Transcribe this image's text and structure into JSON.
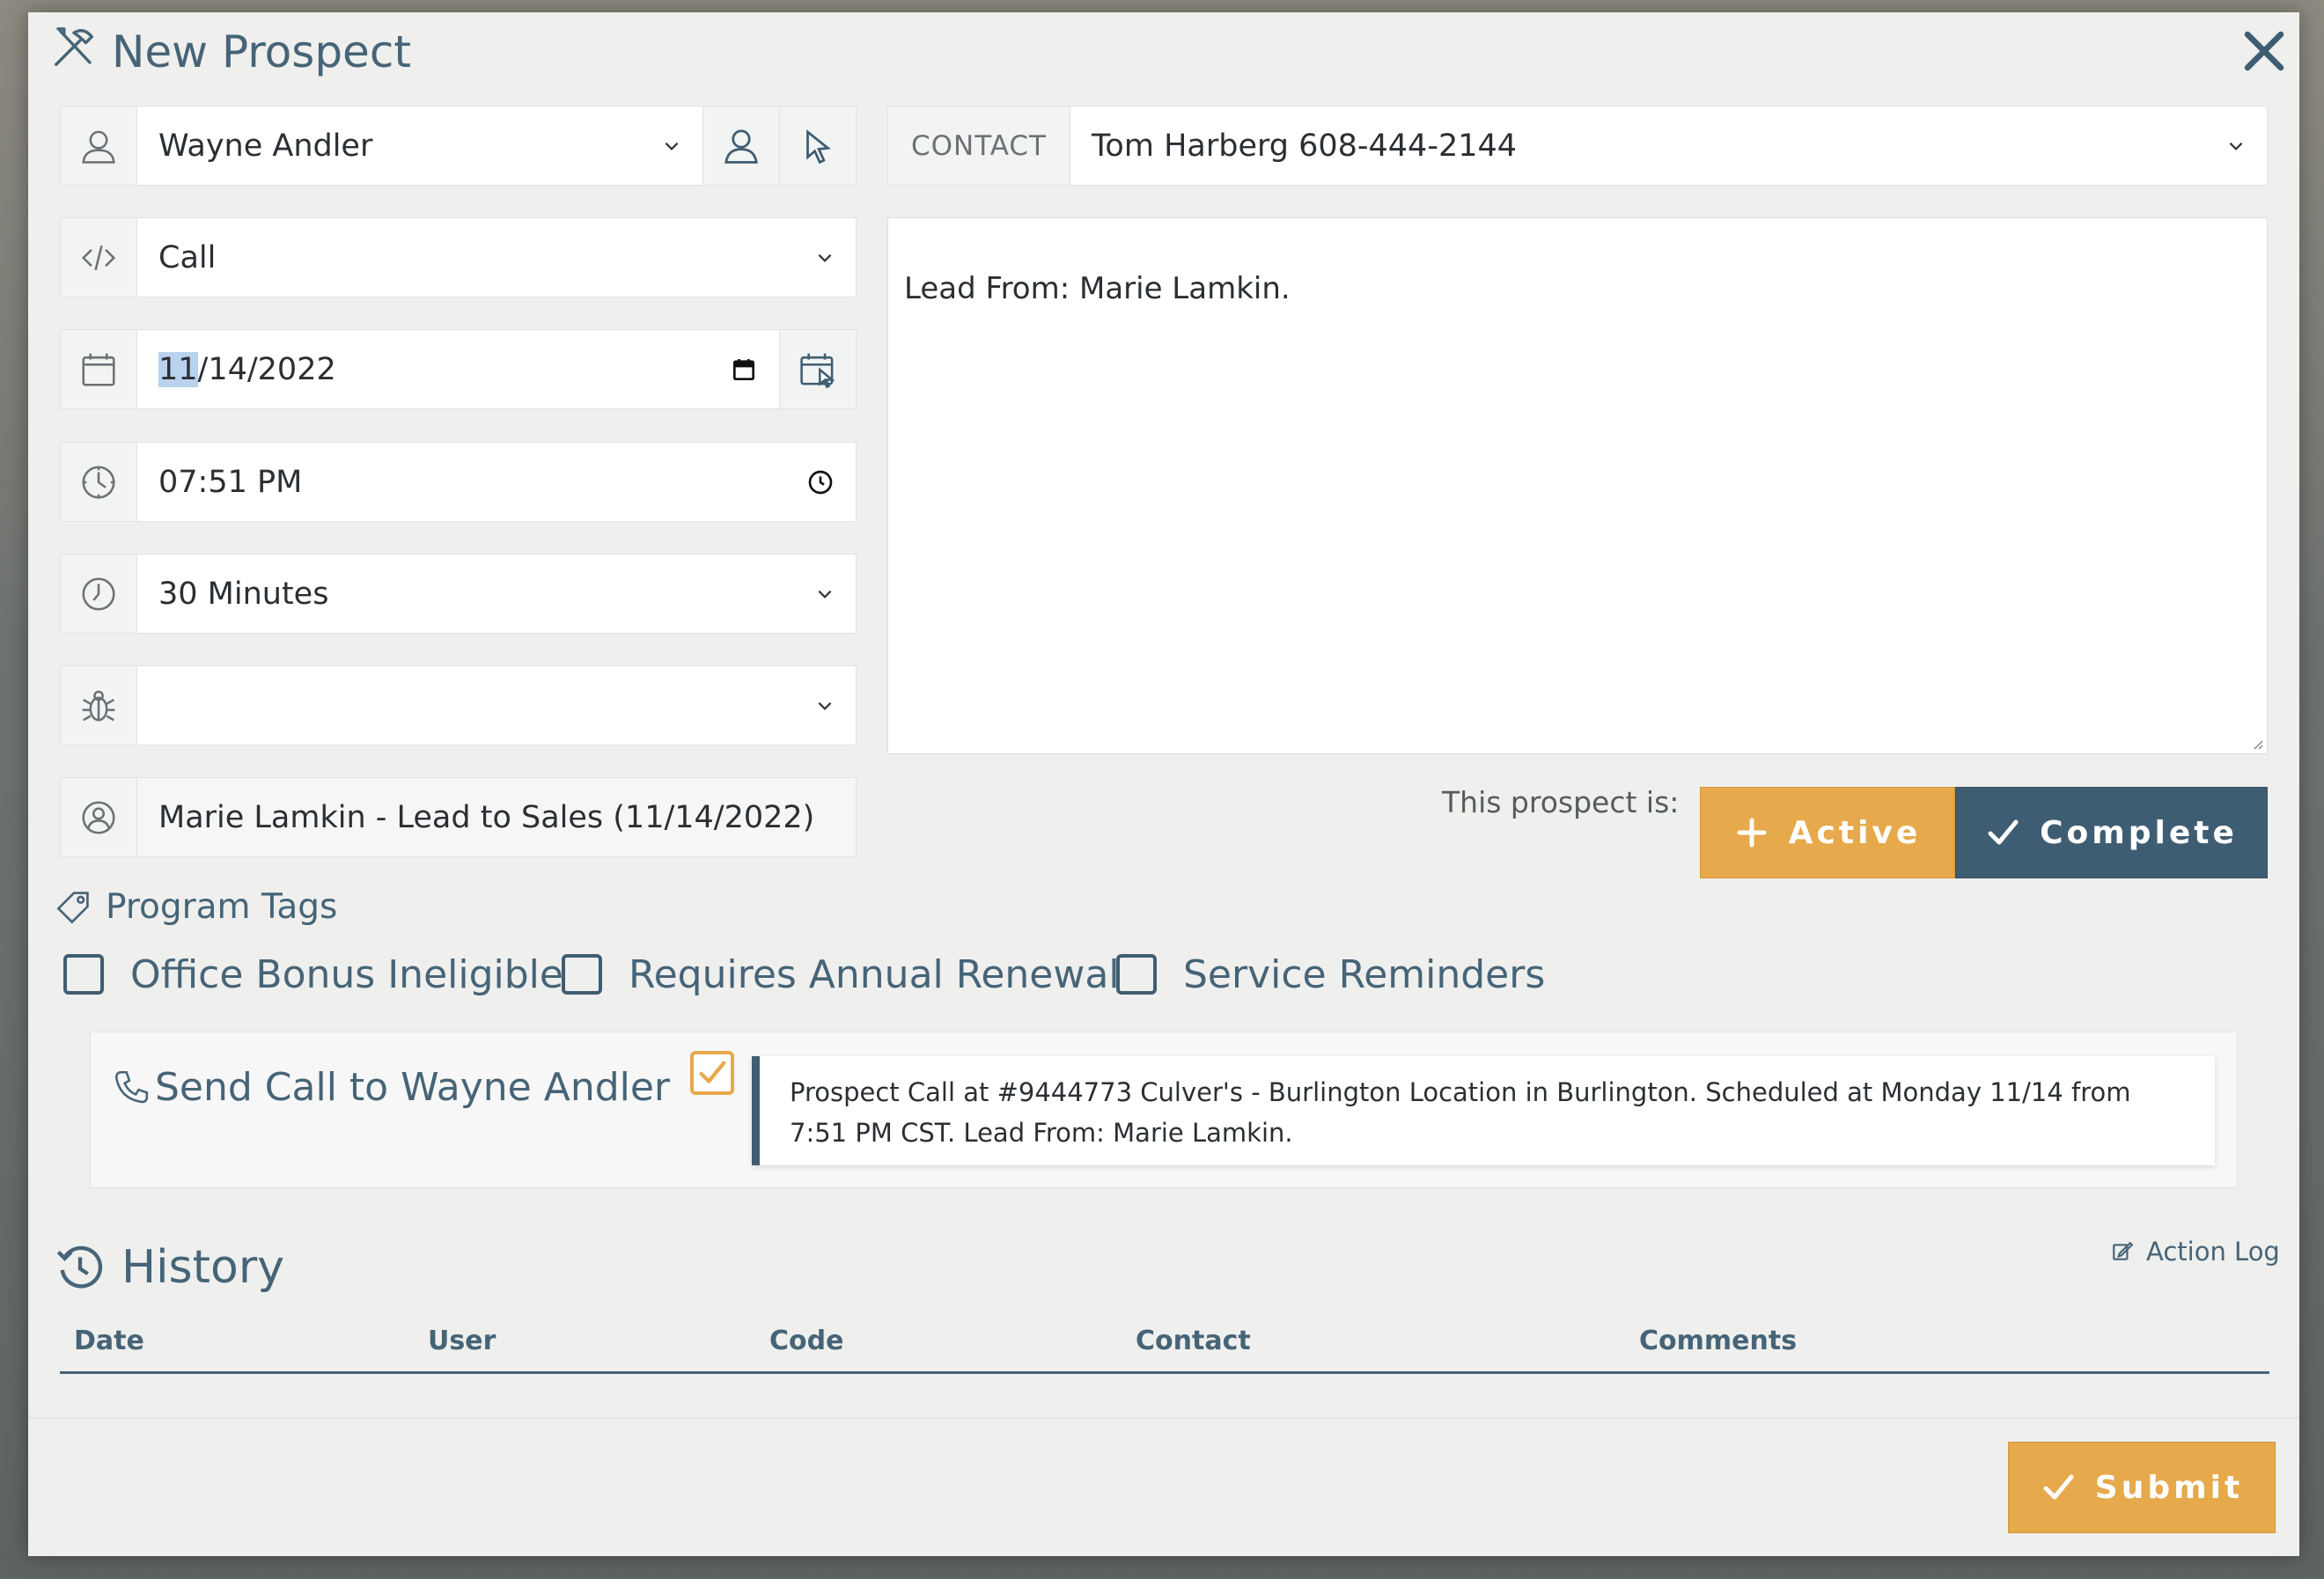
{
  "window": {
    "title": "New Prospect"
  },
  "form": {
    "assignee": "Wayne Andler",
    "code": "Call",
    "date": {
      "highlight": "11",
      "rest": "/14/2022"
    },
    "time": "07:51 PM",
    "duration": "30 Minutes",
    "category": "",
    "lead": "Marie Lamkin - Lead to Sales (11/14/2022)"
  },
  "contact": {
    "label": "CONTACT",
    "value": "Tom Harberg 608-444-2144"
  },
  "notes": {
    "text": "Lead From: Marie Lamkin."
  },
  "status": {
    "label": "This prospect is:",
    "active": "Active",
    "complete": "Complete"
  },
  "tags": {
    "heading": "Program Tags",
    "items": [
      "Office Bonus Ineligible",
      "Requires Annual Renewal",
      "Service Reminders"
    ]
  },
  "send": {
    "label": "Send Call to Wayne Andler",
    "checked": true,
    "message": "Prospect Call at #9444773 Culver's - Burlington Location in Burlington. Scheduled at Monday 11/14 from 7:51 PM CST. Lead From: Marie Lamkin."
  },
  "history": {
    "title": "History",
    "action_log": "Action Log",
    "columns": [
      "Date",
      "User",
      "Code",
      "Contact",
      "Comments"
    ]
  },
  "footer": {
    "submit": "Submit"
  },
  "colors": {
    "accent": "#e6a94b",
    "primary": "#3f5d72",
    "heading": "#466477"
  }
}
